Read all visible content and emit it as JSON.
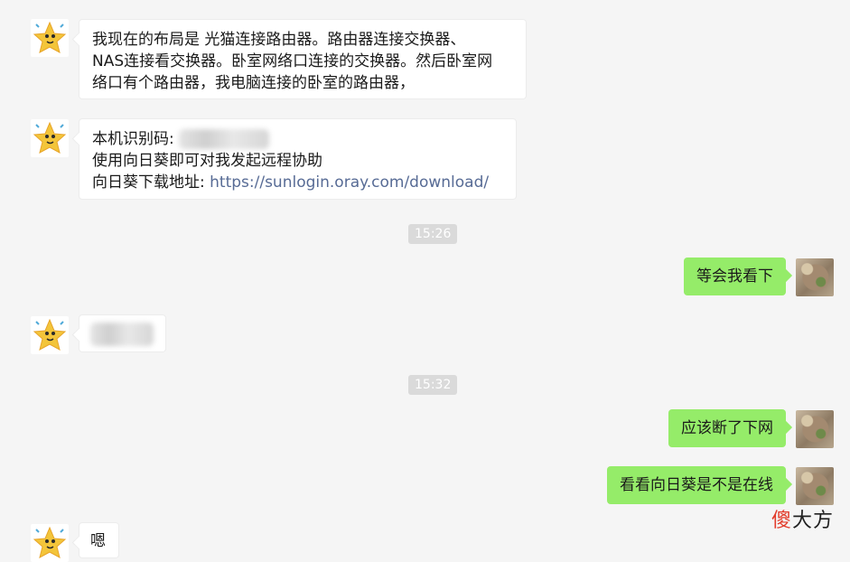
{
  "messages": {
    "m1": {
      "line1": "我现在的布局是 光猫连接路由器。路由器连接交换器、",
      "line2": "NAS连接看交换器。卧室网络口连接的交换器。然后卧室网",
      "line3": "络口有个路由器，我电脑连接的卧室的路由器，"
    },
    "m2": {
      "line1": "本机识别码:",
      "line2": "使用向日葵即可对我发起远程协助",
      "line3_prefix": "向日葵下载地址: ",
      "line3_link": "https://sunlogin.oray.com/download/"
    },
    "t1": "15:26",
    "m3": "等会我看下",
    "t2": "15:32",
    "m5": "应该断了下网",
    "m6": "看看向日葵是不是在线",
    "m7": "嗯"
  },
  "watermark": {
    "part1": "傻",
    "part2": "大方"
  },
  "colors": {
    "outgoing": "#95ec69",
    "incoming": "#ffffff",
    "link": "#576b95",
    "background": "#f5f5f5"
  }
}
